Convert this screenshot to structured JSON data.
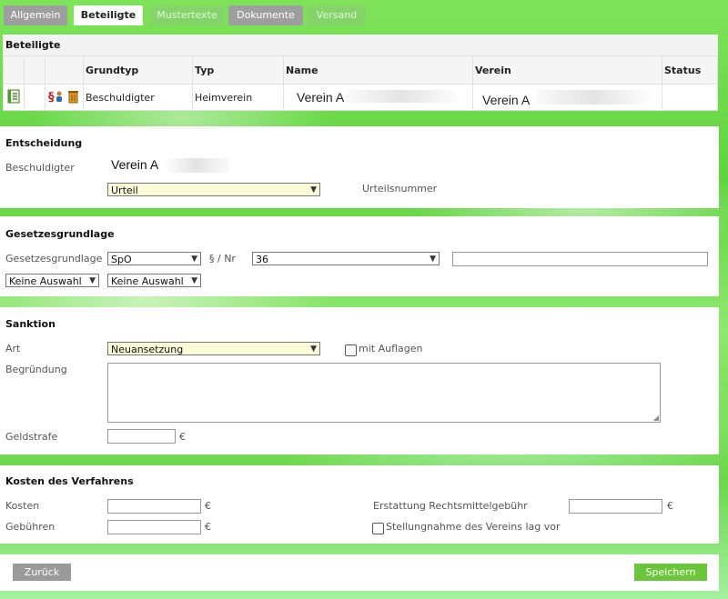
{
  "tabs": [
    {
      "label": "Allgemein",
      "state": "normal"
    },
    {
      "label": "Beteiligte",
      "state": "active"
    },
    {
      "label": "Mustertexte",
      "state": "disabled"
    },
    {
      "label": "Dokumente",
      "state": "normal"
    },
    {
      "label": "Versand",
      "state": "disabled"
    }
  ],
  "beteiligte": {
    "title": "Beteiligte",
    "columns": [
      "",
      "",
      "",
      "Grundtyp",
      "Typ",
      "Name",
      "Verein",
      "Status"
    ],
    "rows": [
      {
        "grundtyp": "Beschuldigter",
        "typ": "Heimverein",
        "name": "Verein A",
        "verein": "Verein A",
        "status": ""
      }
    ],
    "row_icons": [
      "document-list-icon",
      "paragraph-person-icon",
      "trash-icon"
    ]
  },
  "entscheidung": {
    "title": "Entscheidung",
    "beschuldigter_label": "Beschuldigter",
    "beschuldigter_value": "Verein A",
    "entscheidung_select": "Urteil",
    "urteilsnummer_label": "Urteilsnummer"
  },
  "gesetzesgrundlage": {
    "title": "Gesetzesgrundlage",
    "label": "Gesetzesgrundlage",
    "grundlage_select": "SpO",
    "paragraph_label": "§ / Nr",
    "nr_select": "36",
    "extra_input": "",
    "select_a": "Keine Auswahl",
    "select_b": "Keine Auswahl"
  },
  "sanktion": {
    "title": "Sanktion",
    "art_label": "Art",
    "art_select": "Neuansetzung",
    "auflagen_label": "mit Auflagen",
    "begruendung_label": "Begründung",
    "begruendung_value": "",
    "geldstrafe_label": "Geldstrafe",
    "geldstrafe_value": "",
    "currency": "€"
  },
  "kosten": {
    "title": "Kosten des Verfahrens",
    "kosten_label": "Kosten",
    "gebuehren_label": "Gebühren",
    "erstattung_label": "Erstattung Rechtsmittelgebühr",
    "stellungnahme_label": "Stellungnahme des Vereins lag vor",
    "currency": "€"
  },
  "footer": {
    "back_label": "Zurück",
    "save_label": "Speichern"
  },
  "colors": {
    "save_button": "#6cc63c",
    "back_button": "#9a9a9a",
    "select_highlight": "#fdfcd9"
  }
}
